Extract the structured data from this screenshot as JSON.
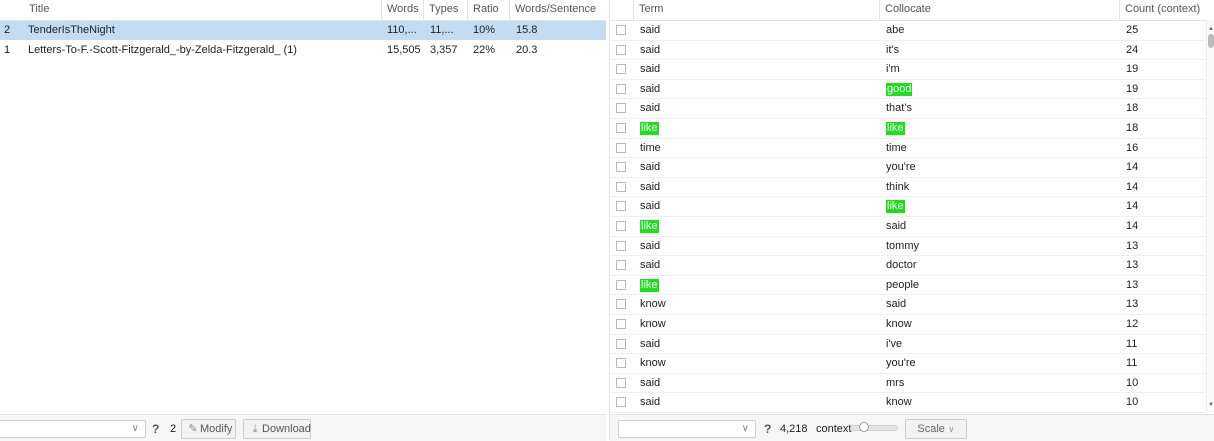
{
  "documents": {
    "columns": [
      "Title",
      "Words",
      "Types",
      "Ratio",
      "Words/Sentence"
    ],
    "rows": [
      {
        "num": "2",
        "title": "TenderIsTheNight",
        "words": "110,...",
        "types": "11,...",
        "ratio": "10%",
        "wps": "15.8",
        "selected": true
      },
      {
        "num": "1",
        "title": "Letters-To-F.-Scott-Fitzgerald_-by-Zelda-Fitzgerald_ (1)",
        "words": "15,505",
        "types": "3,357",
        "ratio": "22%",
        "wps": "20.3",
        "selected": false
      }
    ],
    "footer": {
      "help": "?",
      "count": "2",
      "modify_label": "Modify",
      "download_label": "Download"
    }
  },
  "collocates": {
    "columns": [
      "Term",
      "Collocate",
      "Count (context)"
    ],
    "rows": [
      {
        "term": "said",
        "collocate": "abe",
        "count": "25",
        "term_hl": false,
        "col_hl": false
      },
      {
        "term": "said",
        "collocate": "it's",
        "count": "24",
        "term_hl": false,
        "col_hl": false
      },
      {
        "term": "said",
        "collocate": "i'm",
        "count": "19",
        "term_hl": false,
        "col_hl": false
      },
      {
        "term": "said",
        "collocate": "good",
        "count": "19",
        "term_hl": false,
        "col_hl": true
      },
      {
        "term": "said",
        "collocate": "that's",
        "count": "18",
        "term_hl": false,
        "col_hl": false
      },
      {
        "term": "like",
        "collocate": "like",
        "count": "18",
        "term_hl": true,
        "col_hl": true
      },
      {
        "term": "time",
        "collocate": "time",
        "count": "16",
        "term_hl": false,
        "col_hl": false
      },
      {
        "term": "said",
        "collocate": "you're",
        "count": "14",
        "term_hl": false,
        "col_hl": false
      },
      {
        "term": "said",
        "collocate": "think",
        "count": "14",
        "term_hl": false,
        "col_hl": false
      },
      {
        "term": "said",
        "collocate": "like",
        "count": "14",
        "term_hl": false,
        "col_hl": true
      },
      {
        "term": "like",
        "collocate": "said",
        "count": "14",
        "term_hl": true,
        "col_hl": false
      },
      {
        "term": "said",
        "collocate": "tommy",
        "count": "13",
        "term_hl": false,
        "col_hl": false
      },
      {
        "term": "said",
        "collocate": "doctor",
        "count": "13",
        "term_hl": false,
        "col_hl": false
      },
      {
        "term": "like",
        "collocate": "people",
        "count": "13",
        "term_hl": true,
        "col_hl": false
      },
      {
        "term": "know",
        "collocate": "said",
        "count": "13",
        "term_hl": false,
        "col_hl": false
      },
      {
        "term": "know",
        "collocate": "know",
        "count": "12",
        "term_hl": false,
        "col_hl": false
      },
      {
        "term": "said",
        "collocate": "i've",
        "count": "11",
        "term_hl": false,
        "col_hl": false
      },
      {
        "term": "know",
        "collocate": "you're",
        "count": "11",
        "term_hl": false,
        "col_hl": false
      },
      {
        "term": "said",
        "collocate": "mrs",
        "count": "10",
        "term_hl": false,
        "col_hl": false
      },
      {
        "term": "said",
        "collocate": "know",
        "count": "10",
        "term_hl": false,
        "col_hl": false
      }
    ],
    "footer": {
      "help": "?",
      "total": "4,218",
      "context_label": "context",
      "scale_label": "Scale"
    }
  },
  "colors": {
    "selected_row": "#c2dcf2",
    "highlight": "#1be01b"
  }
}
